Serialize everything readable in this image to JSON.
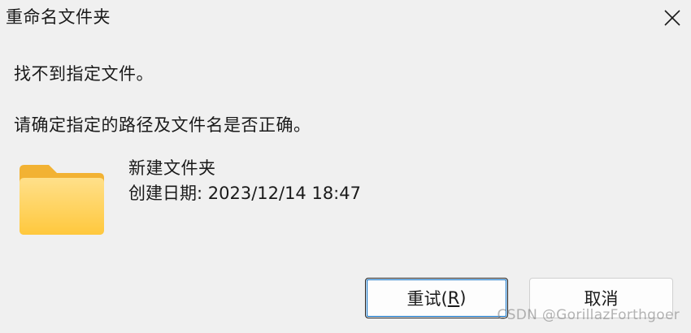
{
  "window": {
    "title": "重命名文件夹",
    "close_icon": "close-icon"
  },
  "message": {
    "line1": "找不到指定文件。",
    "line2": "请确定指定的路径及文件名是否正确。"
  },
  "item": {
    "icon": "folder-icon",
    "name": "新建文件夹",
    "created": "创建日期: 2023/12/14 18:47"
  },
  "buttons": {
    "retry_prefix": "重试(",
    "retry_key": "R",
    "retry_suffix": ")",
    "cancel": "取消"
  },
  "watermark": "CSDN @GorillazForthgoer",
  "colors": {
    "background": "#f0f0f0",
    "focus_ring": "#0067c0",
    "folder_front": "#ffd35c",
    "folder_back": "#f4b63a"
  }
}
